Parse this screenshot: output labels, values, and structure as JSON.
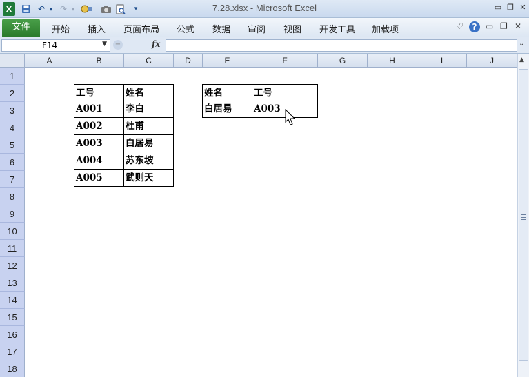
{
  "window": {
    "title": "7.28.xlsx  -  Microsoft Excel",
    "qa_icons": [
      "excel-app-icon",
      "save-icon",
      "undo-icon",
      "redo-icon",
      "tools-icon",
      "camera-icon",
      "print-preview-icon",
      "customize-icon"
    ],
    "controls": [
      "minimize-icon",
      "restore-icon",
      "close-icon"
    ]
  },
  "ribbon": {
    "file_tab": "文件",
    "tabs": [
      "开始",
      "插入",
      "页面布局",
      "公式",
      "数据",
      "审阅",
      "视图",
      "开发工具",
      "加载项"
    ]
  },
  "formula_bar": {
    "name_box": "F14",
    "fx_label": "fx",
    "formula": ""
  },
  "columns": [
    "A",
    "B",
    "C",
    "D",
    "E",
    "F",
    "G",
    "H",
    "I",
    "J"
  ],
  "rows": [
    "1",
    "2",
    "3",
    "4",
    "5",
    "6",
    "7",
    "8",
    "9",
    "10",
    "11",
    "12",
    "13",
    "14",
    "15",
    "16",
    "17",
    "18"
  ],
  "table_left": {
    "header": [
      "工号",
      "姓名"
    ],
    "rows": [
      [
        "A001",
        "李白"
      ],
      [
        "A002",
        "杜甫"
      ],
      [
        "A003",
        "白居易"
      ],
      [
        "A004",
        "苏东坡"
      ],
      [
        "A005",
        "武则天"
      ]
    ]
  },
  "table_right": {
    "header": [
      "姓名",
      "工号"
    ],
    "rows": [
      [
        "白居易",
        "A003"
      ]
    ]
  }
}
